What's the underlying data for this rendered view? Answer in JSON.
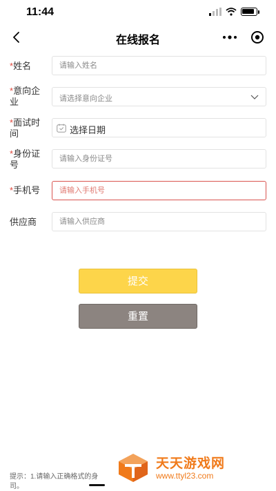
{
  "status_bar": {
    "time": "11:44"
  },
  "nav": {
    "title": "在线报名"
  },
  "form": {
    "name": {
      "label": "姓名",
      "required_mark": "*",
      "placeholder": "请输入姓名"
    },
    "company": {
      "label": "意向企业",
      "required_mark": "*",
      "placeholder": "请选择意向企业"
    },
    "interview_time": {
      "label": "面试时间",
      "required_mark": "*",
      "value": "选择日期"
    },
    "id_number": {
      "label": "身份证号",
      "required_mark": "*",
      "placeholder": "请输入身份证号"
    },
    "phone": {
      "label": "手机号",
      "required_mark": "*",
      "placeholder": "请输入手机号"
    },
    "supplier": {
      "label": "供应商",
      "placeholder": "请输入供应商"
    }
  },
  "buttons": {
    "submit": "提交",
    "reset": "重置"
  },
  "hint": {
    "text": "提示：1.请输入正确格式的身",
    "text_line2": "司。"
  },
  "watermark": {
    "title": "天天游戏网",
    "url": "www.ttyl23.com"
  },
  "colors": {
    "submit_bg": "#fdd54a",
    "reset_bg": "#8c8480",
    "required": "#e0493d",
    "error_border": "#d9534f",
    "watermark": "#f07a1a"
  }
}
